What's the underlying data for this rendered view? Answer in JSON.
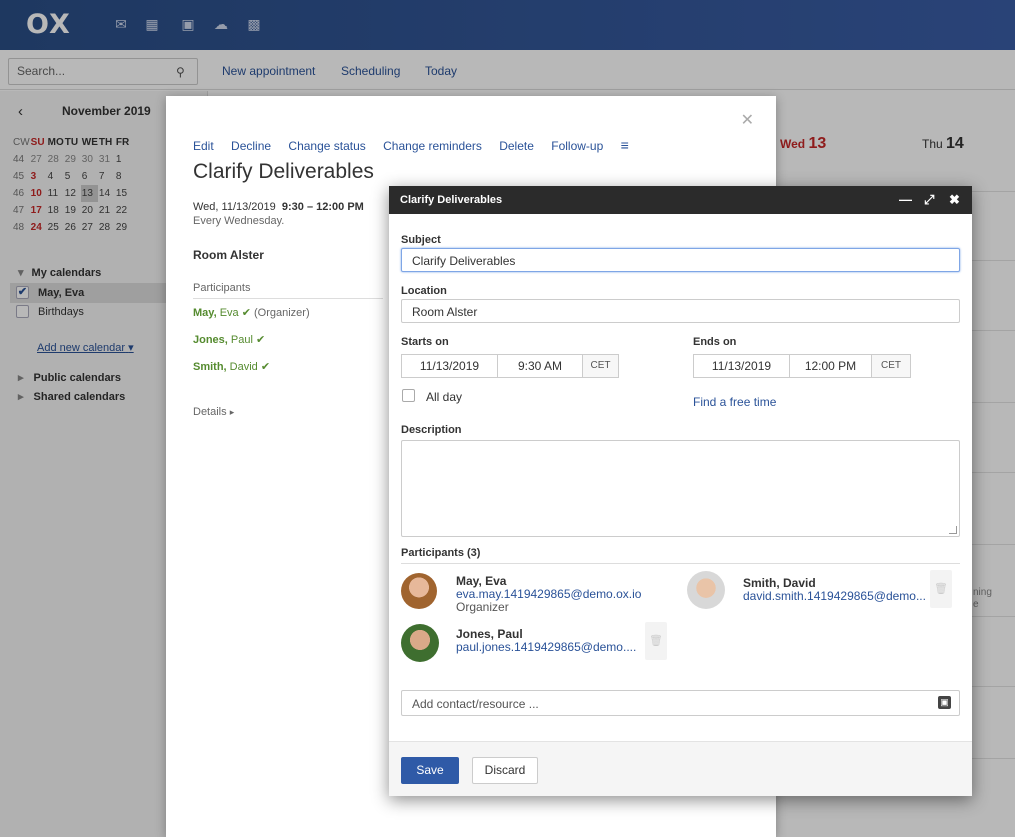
{
  "topbar": {
    "logo": "OX",
    "apps": [
      "mail-icon",
      "calendar-icon",
      "contacts-icon",
      "drive-icon",
      "apps-grid-icon"
    ]
  },
  "toolbar": {
    "search_placeholder": "Search...",
    "new_appointment": "New appointment",
    "scheduling": "Scheduling",
    "today": "Today"
  },
  "sidebar": {
    "month_label": "November 2019",
    "minical": {
      "headers": [
        "CW",
        "SU",
        "MO",
        "TU",
        "WE",
        "TH",
        "FR"
      ],
      "rows": [
        [
          "44",
          "27",
          "28",
          "29",
          "30",
          "31",
          "1"
        ],
        [
          "45",
          "3",
          "4",
          "5",
          "6",
          "7",
          "8"
        ],
        [
          "46",
          "10",
          "11",
          "12",
          "13",
          "14",
          "15"
        ],
        [
          "47",
          "17",
          "18",
          "19",
          "20",
          "21",
          "22"
        ],
        [
          "48",
          "24",
          "25",
          "26",
          "27",
          "28",
          "29"
        ]
      ]
    },
    "my_calendars": "My calendars",
    "cal_may": "May, Eva",
    "cal_birthdays": "Birthdays",
    "add_new_calendar": "Add new calendar",
    "public_calendars": "Public calendars",
    "shared_calendars": "Shared calendars"
  },
  "calendar": {
    "wed_label": "Wed",
    "wed_num": "13",
    "thu_label": "Thu",
    "thu_num": "14",
    "event_snippet": "ning",
    "event_snippet2": "e"
  },
  "detail": {
    "actions": [
      "Edit",
      "Decline",
      "Change status",
      "Change reminders",
      "Delete",
      "Follow-up"
    ],
    "title": "Clarify Deliverables",
    "date": "Wed, 11/13/2019",
    "time": "9:30 – 12:00 PM",
    "recurrence": "Every Wednesday.",
    "room": "Room Alster",
    "participants_label": "Participants",
    "p1_last": "May,",
    "p1_first": " Eva",
    "p1_role": " (Organizer)",
    "p2_last": "Jones,",
    "p2_first": " Paul",
    "p3_last": "Smith,",
    "p3_first": " David",
    "details_label": "Details"
  },
  "dialog": {
    "title": "Clarify Deliverables",
    "subject_label": "Subject",
    "subject_value": "Clarify Deliverables",
    "location_label": "Location",
    "location_value": "Room Alster",
    "starts_label": "Starts on",
    "start_date": "11/13/2019",
    "start_time": "9:30 AM",
    "start_tz": "CET",
    "ends_label": "Ends on",
    "end_date": "11/13/2019",
    "end_time": "12:00 PM",
    "end_tz": "CET",
    "allday_label": "All day",
    "find_free": "Find a free time",
    "description_label": "Description",
    "participants_label": "Participants (3)",
    "participants": [
      {
        "name": "May, Eva",
        "email": "eva.may.1419429865@demo.ox.io",
        "role": "Organizer"
      },
      {
        "name": "Smith, David",
        "email": "david.smith.1419429865@demo..."
      },
      {
        "name": "Jones, Paul",
        "email": "paul.jones.1419429865@demo...."
      }
    ],
    "add_contact_placeholder": "Add contact/resource ...",
    "save": "Save",
    "discard": "Discard"
  }
}
